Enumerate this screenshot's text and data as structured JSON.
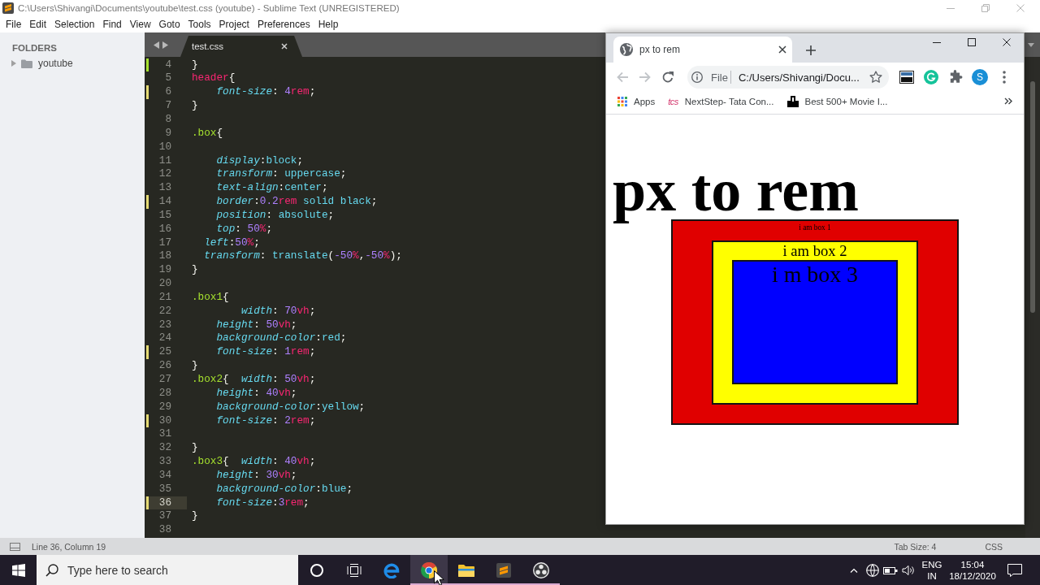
{
  "sublime": {
    "title": "C:\\Users\\Shivangi\\Documents\\youtube\\test.css (youtube) - Sublime Text (UNREGISTERED)",
    "menu": [
      "File",
      "Edit",
      "Selection",
      "Find",
      "View",
      "Goto",
      "Tools",
      "Project",
      "Preferences",
      "Help"
    ],
    "sidebar": {
      "heading": "FOLDERS",
      "folders": [
        {
          "name": "youtube",
          "expanded": false
        }
      ]
    },
    "tabs": [
      {
        "label": "test.css",
        "selected": true
      }
    ],
    "lines": [
      {
        "number": "4",
        "added": true,
        "modified": false,
        "current": false,
        "tokens": [
          {
            "kind": "punct",
            "text": "}"
          }
        ]
      },
      {
        "number": "5",
        "added": false,
        "modified": false,
        "current": false,
        "tokens": [
          {
            "kind": "tag",
            "text": "header"
          },
          {
            "kind": "punct",
            "text": "{"
          }
        ]
      },
      {
        "number": "6",
        "added": false,
        "modified": true,
        "current": false,
        "tokens": [
          {
            "kind": "prop",
            "text": "    font-size"
          },
          {
            "kind": "punct",
            "text": ": "
          },
          {
            "kind": "num",
            "text": "4"
          },
          {
            "kind": "unit",
            "text": "rem"
          },
          {
            "kind": "punct",
            "text": ";"
          }
        ]
      },
      {
        "number": "7",
        "added": false,
        "modified": false,
        "current": false,
        "tokens": [
          {
            "kind": "punct",
            "text": "}"
          }
        ]
      },
      {
        "number": "8",
        "added": false,
        "modified": false,
        "current": false
      },
      {
        "number": "9",
        "added": false,
        "modified": false,
        "current": false,
        "tokens": [
          {
            "kind": "class",
            "text": ".box"
          },
          {
            "kind": "punct",
            "text": "{"
          }
        ]
      },
      {
        "number": "10",
        "added": false,
        "modified": false,
        "current": false
      },
      {
        "number": "11",
        "added": false,
        "modified": false,
        "current": false,
        "tokens": [
          {
            "kind": "prop",
            "text": "    display"
          },
          {
            "kind": "punct",
            "text": ":"
          },
          {
            "kind": "value",
            "text": "block"
          },
          {
            "kind": "punct",
            "text": ";"
          }
        ]
      },
      {
        "number": "12",
        "added": false,
        "modified": false,
        "current": false,
        "tokens": [
          {
            "kind": "prop",
            "text": "    transform"
          },
          {
            "kind": "punct",
            "text": ": "
          },
          {
            "kind": "value",
            "text": "uppercase"
          },
          {
            "kind": "punct",
            "text": ";"
          }
        ]
      },
      {
        "number": "13",
        "added": false,
        "modified": false,
        "current": false,
        "tokens": [
          {
            "kind": "prop",
            "text": "    text-align"
          },
          {
            "kind": "punct",
            "text": ":"
          },
          {
            "kind": "value",
            "text": "center"
          },
          {
            "kind": "punct",
            "text": ";"
          }
        ]
      },
      {
        "number": "14",
        "added": false,
        "modified": true,
        "current": false,
        "tokens": [
          {
            "kind": "prop",
            "text": "    border"
          },
          {
            "kind": "punct",
            "text": ":"
          },
          {
            "kind": "num",
            "text": "0.2"
          },
          {
            "kind": "unit",
            "text": "rem"
          },
          {
            "kind": "value",
            "text": " solid black"
          },
          {
            "kind": "punct",
            "text": ";"
          }
        ]
      },
      {
        "number": "15",
        "added": false,
        "modified": false,
        "current": false,
        "tokens": [
          {
            "kind": "prop",
            "text": "    position"
          },
          {
            "kind": "punct",
            "text": ": "
          },
          {
            "kind": "value",
            "text": "absolute"
          },
          {
            "kind": "punct",
            "text": ";"
          }
        ]
      },
      {
        "number": "16",
        "added": false,
        "modified": false,
        "current": false,
        "tokens": [
          {
            "kind": "prop",
            "text": "    top"
          },
          {
            "kind": "punct",
            "text": ": "
          },
          {
            "kind": "num",
            "text": "50"
          },
          {
            "kind": "unit",
            "text": "%"
          },
          {
            "kind": "punct",
            "text": ";"
          }
        ]
      },
      {
        "number": "17",
        "added": false,
        "modified": false,
        "current": false,
        "tokens": [
          {
            "kind": "prop",
            "text": "  left"
          },
          {
            "kind": "punct",
            "text": ":"
          },
          {
            "kind": "num",
            "text": "50"
          },
          {
            "kind": "unit",
            "text": "%"
          },
          {
            "kind": "punct",
            "text": ";"
          }
        ]
      },
      {
        "number": "18",
        "added": false,
        "modified": false,
        "current": false,
        "tokens": [
          {
            "kind": "prop",
            "text": "  transform"
          },
          {
            "kind": "punct",
            "text": ": "
          },
          {
            "kind": "value",
            "text": "translate"
          },
          {
            "kind": "punct",
            "text": "("
          },
          {
            "kind": "num",
            "text": "-50"
          },
          {
            "kind": "unit",
            "text": "%"
          },
          {
            "kind": "punct",
            "text": ","
          },
          {
            "kind": "num",
            "text": "-50"
          },
          {
            "kind": "unit",
            "text": "%"
          },
          {
            "kind": "punct",
            "text": ");"
          }
        ]
      },
      {
        "number": "19",
        "added": false,
        "modified": false,
        "current": false,
        "tokens": [
          {
            "kind": "punct",
            "text": "}"
          }
        ]
      },
      {
        "number": "20",
        "added": false,
        "modified": false,
        "current": false
      },
      {
        "number": "21",
        "added": false,
        "modified": false,
        "current": false,
        "tokens": [
          {
            "kind": "class",
            "text": ".box1"
          },
          {
            "kind": "punct",
            "text": "{"
          }
        ]
      },
      {
        "number": "22",
        "added": false,
        "modified": false,
        "current": false,
        "tokens": [
          {
            "kind": "prop",
            "text": "        width"
          },
          {
            "kind": "punct",
            "text": ": "
          },
          {
            "kind": "num",
            "text": "70"
          },
          {
            "kind": "unit",
            "text": "vh"
          },
          {
            "kind": "punct",
            "text": ";"
          }
        ]
      },
      {
        "number": "23",
        "added": false,
        "modified": false,
        "current": false,
        "tokens": [
          {
            "kind": "prop",
            "text": "    height"
          },
          {
            "kind": "punct",
            "text": ": "
          },
          {
            "kind": "num",
            "text": "50"
          },
          {
            "kind": "unit",
            "text": "vh"
          },
          {
            "kind": "punct",
            "text": ";"
          }
        ]
      },
      {
        "number": "24",
        "added": false,
        "modified": false,
        "current": false,
        "tokens": [
          {
            "kind": "prop",
            "text": "    background-color"
          },
          {
            "kind": "punct",
            "text": ":"
          },
          {
            "kind": "value",
            "text": "red"
          },
          {
            "kind": "punct",
            "text": ";"
          }
        ]
      },
      {
        "number": "25",
        "added": false,
        "modified": true,
        "current": false,
        "tokens": [
          {
            "kind": "prop",
            "text": "    font-size"
          },
          {
            "kind": "punct",
            "text": ": "
          },
          {
            "kind": "num",
            "text": "1"
          },
          {
            "kind": "unit",
            "text": "rem"
          },
          {
            "kind": "punct",
            "text": ";"
          }
        ]
      },
      {
        "number": "26",
        "added": false,
        "modified": false,
        "current": false,
        "tokens": [
          {
            "kind": "punct",
            "text": "}"
          }
        ]
      },
      {
        "number": "27",
        "added": false,
        "modified": false,
        "current": false,
        "tokens": [
          {
            "kind": "class",
            "text": ".box2"
          },
          {
            "kind": "punct",
            "text": "{  "
          },
          {
            "kind": "prop",
            "text": "width"
          },
          {
            "kind": "punct",
            "text": ": "
          },
          {
            "kind": "num",
            "text": "50"
          },
          {
            "kind": "unit",
            "text": "vh"
          },
          {
            "kind": "punct",
            "text": ";"
          }
        ]
      },
      {
        "number": "28",
        "added": false,
        "modified": false,
        "current": false,
        "tokens": [
          {
            "kind": "prop",
            "text": "    height"
          },
          {
            "kind": "punct",
            "text": ": "
          },
          {
            "kind": "num",
            "text": "40"
          },
          {
            "kind": "unit",
            "text": "vh"
          },
          {
            "kind": "punct",
            "text": ";"
          }
        ]
      },
      {
        "number": "29",
        "added": false,
        "modified": false,
        "current": false,
        "tokens": [
          {
            "kind": "prop",
            "text": "    background-color"
          },
          {
            "kind": "punct",
            "text": ":"
          },
          {
            "kind": "value",
            "text": "yellow"
          },
          {
            "kind": "punct",
            "text": ";"
          }
        ]
      },
      {
        "number": "30",
        "added": false,
        "modified": true,
        "current": false,
        "tokens": [
          {
            "kind": "prop",
            "text": "    font-size"
          },
          {
            "kind": "punct",
            "text": ": "
          },
          {
            "kind": "num",
            "text": "2"
          },
          {
            "kind": "unit",
            "text": "rem"
          },
          {
            "kind": "punct",
            "text": ";"
          }
        ]
      },
      {
        "number": "31",
        "added": false,
        "modified": false,
        "current": false
      },
      {
        "number": "32",
        "added": false,
        "modified": false,
        "current": false,
        "tokens": [
          {
            "kind": "punct",
            "text": "}"
          }
        ]
      },
      {
        "number": "33",
        "added": false,
        "modified": false,
        "current": false,
        "tokens": [
          {
            "kind": "class",
            "text": ".box3"
          },
          {
            "kind": "punct",
            "text": "{  "
          },
          {
            "kind": "prop",
            "text": "width"
          },
          {
            "kind": "punct",
            "text": ": "
          },
          {
            "kind": "num",
            "text": "40"
          },
          {
            "kind": "unit",
            "text": "vh"
          },
          {
            "kind": "punct",
            "text": ";"
          }
        ]
      },
      {
        "number": "34",
        "added": false,
        "modified": false,
        "current": false,
        "tokens": [
          {
            "kind": "prop",
            "text": "    height"
          },
          {
            "kind": "punct",
            "text": ": "
          },
          {
            "kind": "num",
            "text": "30"
          },
          {
            "kind": "unit",
            "text": "vh"
          },
          {
            "kind": "punct",
            "text": ";"
          }
        ]
      },
      {
        "number": "35",
        "added": false,
        "modified": false,
        "current": false,
        "tokens": [
          {
            "kind": "prop",
            "text": "    background-color"
          },
          {
            "kind": "punct",
            "text": ":"
          },
          {
            "kind": "value",
            "text": "blue"
          },
          {
            "kind": "punct",
            "text": ";"
          }
        ]
      },
      {
        "number": "36",
        "added": false,
        "modified": true,
        "current": true,
        "tokens": [
          {
            "kind": "prop",
            "text": "    font-size"
          },
          {
            "kind": "punct",
            "text": ":"
          },
          {
            "kind": "num",
            "text": "3"
          },
          {
            "kind": "unit",
            "text": "rem"
          },
          {
            "kind": "punct",
            "text": ";"
          }
        ]
      },
      {
        "number": "37",
        "added": false,
        "modified": false,
        "current": false,
        "tokens": [
          {
            "kind": "punct",
            "text": "}"
          }
        ]
      },
      {
        "number": "38",
        "added": false,
        "modified": false,
        "current": false
      }
    ],
    "status": {
      "position": "Line 36, Column 19",
      "tab_size": "Tab Size: 4",
      "syntax": "CSS"
    }
  },
  "browser": {
    "tabs": [
      {
        "title": "px to rem",
        "selected": true
      }
    ],
    "nav": [
      {
        "kind": "back",
        "disabled": true
      },
      {
        "kind": "forward",
        "disabled": true
      },
      {
        "kind": "reload",
        "disabled": false
      }
    ],
    "address": {
      "scheme": "File",
      "url": "C:/Users/Shivangi/Docu...",
      "bookmarked": false
    },
    "profile": "S",
    "bookmarks": [
      {
        "kind": "apps",
        "label": "Apps"
      },
      {
        "kind": "tcs",
        "icon_text": "tcs",
        "label": "NextStep- Tata Con..."
      },
      {
        "kind": "movie",
        "label": "Best 500+ Movie I..."
      }
    ],
    "page": {
      "heading": "px to rem",
      "boxes": [
        {
          "label": "i am box 1",
          "color": "#e00000",
          "children": [
            {
              "label": "i am box 2",
              "color": "#ffff00",
              "children": [
                {
                  "label": "i m box 3",
                  "color": "#0000ff"
                }
              ]
            }
          ]
        }
      ]
    }
  },
  "taskbar": {
    "search": {
      "placeholder": "Type here to search"
    },
    "items": [
      {
        "kind": "cortana",
        "running": false,
        "active": false
      },
      {
        "kind": "task_view",
        "running": false,
        "active": false
      },
      {
        "kind": "edge",
        "running": false,
        "active": false
      },
      {
        "kind": "chrome",
        "running": true,
        "active": true
      },
      {
        "kind": "explorer",
        "running": true,
        "active": false
      },
      {
        "kind": "sublime",
        "running": true,
        "active": false
      },
      {
        "kind": "obs",
        "running": true,
        "active": false
      }
    ],
    "language": "ENG",
    "region": "IN",
    "time": "15:04",
    "date": "18/12/2020"
  }
}
